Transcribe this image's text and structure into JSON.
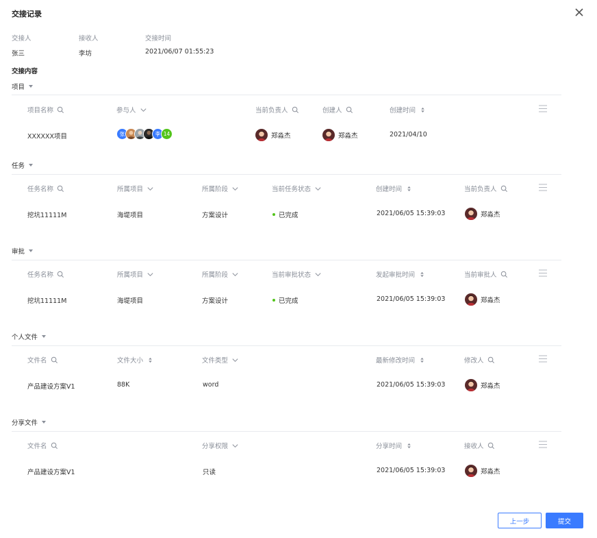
{
  "dialog": {
    "title": "交接记录"
  },
  "meta": {
    "handover_by_label": "交接人",
    "handover_by": "张三",
    "receiver_label": "接收人",
    "receiver": "李坊",
    "time_label": "交接时间",
    "time": "2021/06/07 01:55:23"
  },
  "content_heading": "交接内容",
  "colors": {
    "accent": "#3a7bff",
    "done": "#52c41a",
    "muted": "#8a8f99"
  },
  "project": {
    "title": "项目",
    "headers": {
      "name": "项目名称",
      "participants": "参与人",
      "owner": "当前负责人",
      "creator": "创建人",
      "created": "创建时间"
    },
    "row": {
      "name": "XXXXXX项目",
      "participants": [
        "张",
        "avatar",
        "avatar",
        "avatar",
        "李",
        "14"
      ],
      "owner": "郑淼杰",
      "creator": "郑淼杰",
      "created": "2021/04/10"
    }
  },
  "task": {
    "title": "任务",
    "headers": {
      "name": "任务名称",
      "project": "所属项目",
      "stage": "所属阶段",
      "status": "当前任务状态",
      "created": "创建时间",
      "owner": "当前负责人"
    },
    "row": {
      "name": "挖坑11111M",
      "project": "海堤项目",
      "stage": "方案设计",
      "status": "已完成",
      "created": "2021/06/05 15:39:03",
      "owner": "郑淼杰"
    }
  },
  "approval": {
    "title": "审批",
    "headers": {
      "name": "任务名称",
      "project": "所属项目",
      "stage": "所属阶段",
      "status": "当前审批状态",
      "started": "发起审批时间",
      "approver": "当前审批人"
    },
    "row": {
      "name": "挖坑11111M",
      "project": "海堤项目",
      "stage": "方案设计",
      "status": "已完成",
      "started": "2021/06/05 15:39:03",
      "approver": "郑淼杰"
    }
  },
  "personal_files": {
    "title": "个人文件",
    "headers": {
      "name": "文件名",
      "size": "文件大小",
      "type": "文件类型",
      "modified": "最新修改时间",
      "modifier": "修改人"
    },
    "row": {
      "name": "产品建设方案V1",
      "size": "88K",
      "type": "word",
      "modified": "2021/06/05 15:39:03",
      "modifier": "郑淼杰"
    }
  },
  "shared_files": {
    "title": "分享文件",
    "headers": {
      "name": "文件名",
      "permission": "分享权限",
      "shared": "分享时间",
      "receiver": "接收人"
    },
    "row": {
      "name": "产品建设方案V1",
      "permission": "只读",
      "shared": "2021/06/05 15:39:03",
      "receiver": "郑淼杰"
    }
  },
  "buttons": {
    "prev": "上一步",
    "submit": "提交"
  }
}
